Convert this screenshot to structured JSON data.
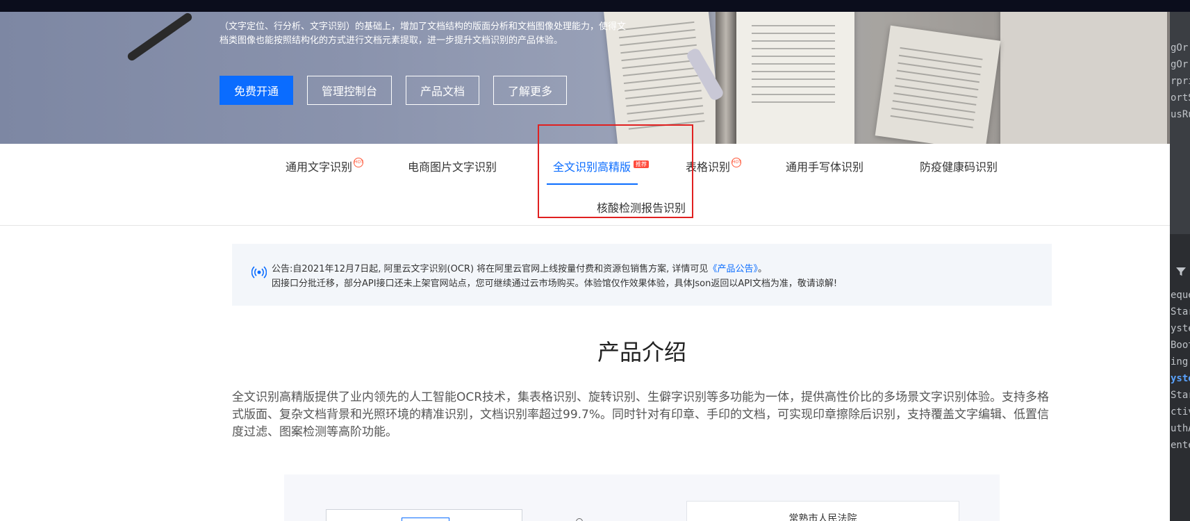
{
  "hero": {
    "desc_line1": "（文字定位、行分析、文字识别）的基础上，增加了文档结构的版面分析和文档图像处理能力，使得文",
    "desc_line2": "档类图像也能按照结构化的方式进行文档元素提取，进一步提升文档识别的产品体验。",
    "buttons": [
      {
        "label": "免费开通"
      },
      {
        "label": "管理控制台"
      },
      {
        "label": "产品文档"
      },
      {
        "label": "了解更多"
      }
    ]
  },
  "tabs": {
    "items": [
      {
        "label": "通用文字识别",
        "badge": "hot"
      },
      {
        "label": "电商图片文字识别"
      },
      {
        "label": "全文识别高精版",
        "badge_text": "推荐"
      },
      {
        "label": "表格识别",
        "badge": "hot"
      },
      {
        "label": "通用手写体识别"
      },
      {
        "label": "防疫健康码识别"
      },
      {
        "label": "核酸检测报告识别"
      }
    ],
    "active_index": 2
  },
  "notice": {
    "line1_prefix": "公告:自2021年12月7日起, 阿里云文字识别(OCR) 将在阿里云官网上线按量付费和资源包销售方案, 详情可见",
    "line1_link": "《产品公告》",
    "line1_suffix": "。",
    "line2": "因接口分批迁移，部分API接口还未上架官网站点，您可继续通过云市场购买。体验馆仅作效果体验，具体Json返回以API文档为准，敬请谅解!"
  },
  "product": {
    "title": "产品介绍",
    "intro": "全文识别高精版提供了业内领先的人工智能OCR技术，集表格识别、旋转识别、生僻字识别等多功能为一体，提供高性价比的多场景文字识别体验。支持多格式版面、复杂文档背景和光照环境的精准识别，文档识别率超过99.7%。同时针对有印章、手印的文档，可实现印章擦除后识别，支持覆盖文字编辑、低置信度过滤、图案检测等高阶功能。"
  },
  "demo": {
    "right_card_title": "常熟市人民法院"
  },
  "side_panel": {
    "lines": [
      "gOr",
      "gOr",
      "rpris",
      "ortSe",
      "usRu",
      "eque",
      "Start",
      "yster",
      "Boot",
      "ing",
      "yster",
      "Start",
      "ctivit",
      "uthA",
      "ente"
    ]
  },
  "colors": {
    "primary": "#0a6cff",
    "highlight_box": "#e02020",
    "hot_badge": "#ff5a3c"
  }
}
